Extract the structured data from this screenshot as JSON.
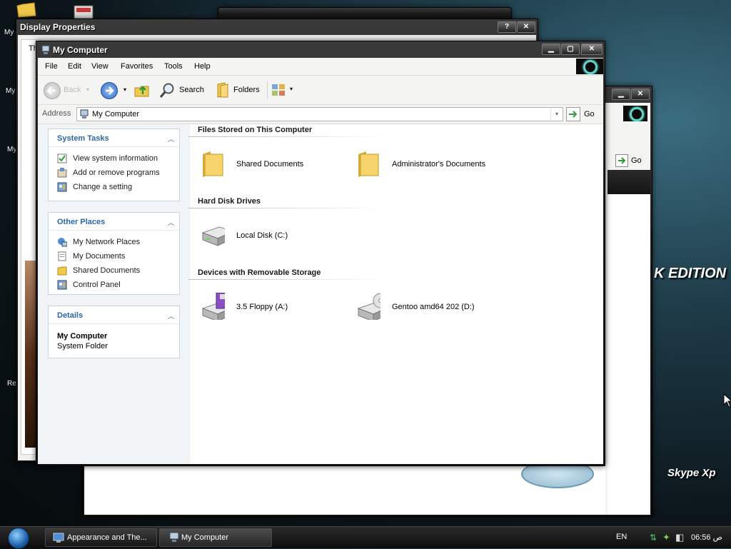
{
  "desktop": {
    "icon_labels": [
      "My",
      "My",
      "My",
      "Re"
    ],
    "overlay_text": "K EDITION",
    "skype_text": "Skype Xp"
  },
  "background_windows": {
    "display_properties_title": "Display Properties",
    "display_properties_tab": "Th",
    "right_window_go": "Go"
  },
  "window": {
    "title": "My Computer",
    "menu": [
      "File",
      "Edit",
      "View",
      "Favorites",
      "Tools",
      "Help"
    ],
    "toolbar": {
      "back": "Back",
      "search": "Search",
      "folders": "Folders"
    },
    "address": {
      "label": "Address",
      "value": "My Computer",
      "go": "Go"
    }
  },
  "taskpane": {
    "system_tasks": {
      "title": "System Tasks",
      "items": [
        "View system information",
        "Add or remove programs",
        "Change a setting"
      ]
    },
    "other_places": {
      "title": "Other Places",
      "items": [
        "My Network Places",
        "My Documents",
        "Shared Documents",
        "Control Panel"
      ]
    },
    "details": {
      "title": "Details",
      "name": "My Computer",
      "type": "System Folder"
    }
  },
  "content": {
    "groups": [
      {
        "title": "Files Stored on This Computer",
        "items": [
          "Shared Documents",
          "Administrator's Documents"
        ]
      },
      {
        "title": "Hard Disk Drives",
        "items": [
          "Local Disk (C:)"
        ]
      },
      {
        "title": "Devices with Removable Storage",
        "items": [
          "3.5 Floppy (A:)",
          "Gentoo amd64 202 (D:)"
        ]
      }
    ]
  },
  "taskbar": {
    "buttons": [
      "Appearance and The...",
      "My Computer"
    ],
    "language": "EN",
    "clock": "06:56 ص"
  },
  "colors": {
    "accent_blue": "#2c66a8",
    "go_green": "#2f9b3e"
  }
}
